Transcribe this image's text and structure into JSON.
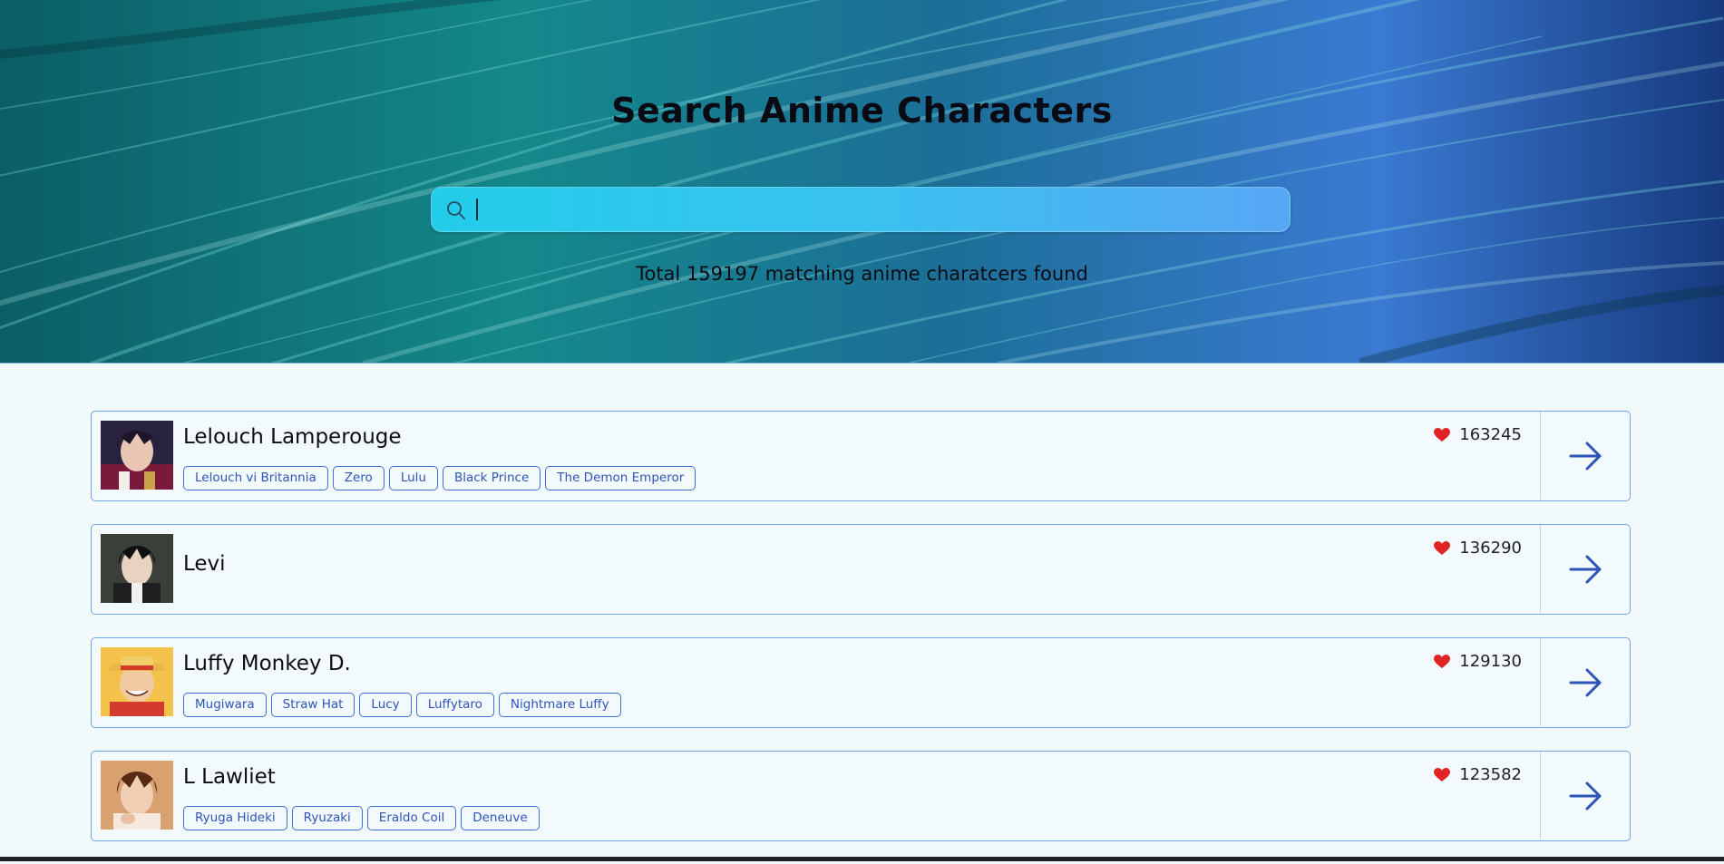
{
  "header": {
    "title": "Search Anime Characters",
    "result_count": "Total 159197 matching anime charatcers found"
  },
  "search": {
    "value": "",
    "placeholder": "",
    "icon": "search-icon"
  },
  "characters": [
    {
      "name": "Lelouch Lamperouge",
      "likes": "163245",
      "tags": [
        "Lelouch vi Britannia",
        "Zero",
        "Lulu",
        "Black Prince",
        "The Demon Emperor"
      ]
    },
    {
      "name": "Levi",
      "likes": "136290",
      "tags": []
    },
    {
      "name": "Luffy Monkey D.",
      "likes": "129130",
      "tags": [
        "Mugiwara",
        "Straw Hat",
        "Lucy",
        "Luffytaro",
        "Nightmare Luffy"
      ]
    },
    {
      "name": "L Lawliet",
      "likes": "123582",
      "tags": [
        "Ryuga Hideki",
        "Ryuzaki",
        "Eraldo Coil",
        "Deneuve"
      ]
    }
  ],
  "colors": {
    "accent": "#2f54b8",
    "heart": "#e02424",
    "card_border": "#6ea6e6"
  },
  "icons": {
    "like": "heart-icon",
    "open": "arrow-right-icon"
  }
}
